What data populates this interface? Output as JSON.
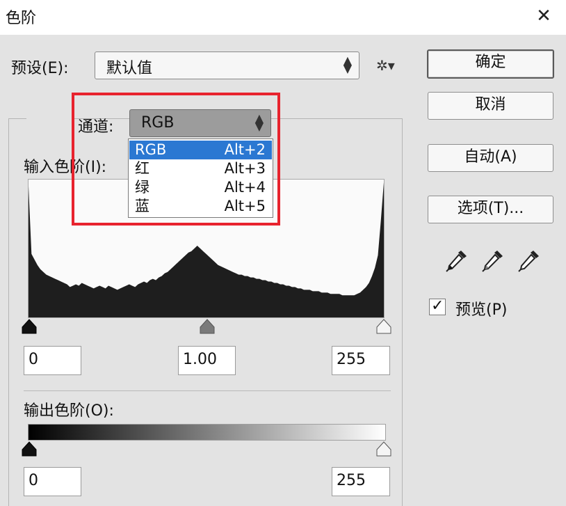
{
  "window": {
    "title": "色阶",
    "close_glyph": "✕"
  },
  "preset": {
    "label": "预设(E):",
    "value": "默认值",
    "gear_glyph": "✲▾"
  },
  "channel": {
    "label": "通道:",
    "value": "RGB",
    "options": [
      {
        "name": "RGB",
        "shortcut": "Alt+2"
      },
      {
        "name": "红",
        "shortcut": "Alt+3"
      },
      {
        "name": "绿",
        "shortcut": "Alt+4"
      },
      {
        "name": "蓝",
        "shortcut": "Alt+5"
      }
    ],
    "selected_option": "RGB"
  },
  "input_levels": {
    "label": "输入色阶(I):",
    "black": "0",
    "gamma": "1.00",
    "white": "255"
  },
  "output_levels": {
    "label": "输出色阶(O):",
    "black": "0",
    "white": "255"
  },
  "buttons": {
    "ok": "确定",
    "cancel": "取消",
    "auto": "自动(A)",
    "options": "选项(T)..."
  },
  "preview": {
    "label": "预览(P)",
    "checked": true,
    "check_glyph": "✓"
  },
  "histogram": {
    "range": [
      0,
      255
    ],
    "relative_counts": [
      0.95,
      0.46,
      0.42,
      0.38,
      0.35,
      0.33,
      0.31,
      0.3,
      0.29,
      0.28,
      0.27,
      0.26,
      0.25,
      0.24,
      0.22,
      0.23,
      0.24,
      0.23,
      0.25,
      0.24,
      0.23,
      0.22,
      0.21,
      0.22,
      0.23,
      0.22,
      0.21,
      0.23,
      0.22,
      0.21,
      0.2,
      0.21,
      0.22,
      0.23,
      0.24,
      0.23,
      0.22,
      0.24,
      0.25,
      0.26,
      0.25,
      0.27,
      0.28,
      0.27,
      0.29,
      0.3,
      0.32,
      0.33,
      0.35,
      0.37,
      0.39,
      0.41,
      0.43,
      0.45,
      0.47,
      0.48,
      0.5,
      0.52,
      0.5,
      0.48,
      0.46,
      0.44,
      0.42,
      0.4,
      0.38,
      0.37,
      0.36,
      0.35,
      0.34,
      0.33,
      0.32,
      0.31,
      0.31,
      0.3,
      0.3,
      0.29,
      0.29,
      0.28,
      0.28,
      0.27,
      0.27,
      0.26,
      0.26,
      0.25,
      0.25,
      0.24,
      0.24,
      0.23,
      0.23,
      0.22,
      0.22,
      0.21,
      0.21,
      0.2,
      0.2,
      0.2,
      0.19,
      0.19,
      0.19,
      0.18,
      0.18,
      0.18,
      0.17,
      0.17,
      0.17,
      0.17,
      0.16,
      0.16,
      0.16,
      0.16,
      0.16,
      0.17,
      0.18,
      0.2,
      0.22,
      0.25,
      0.3,
      0.36,
      0.45,
      0.7,
      0.98
    ]
  },
  "colors": {
    "selection": "#2b78d2",
    "highlight_border": "#e8232e",
    "histogram_fill": "#1e1e1e"
  }
}
